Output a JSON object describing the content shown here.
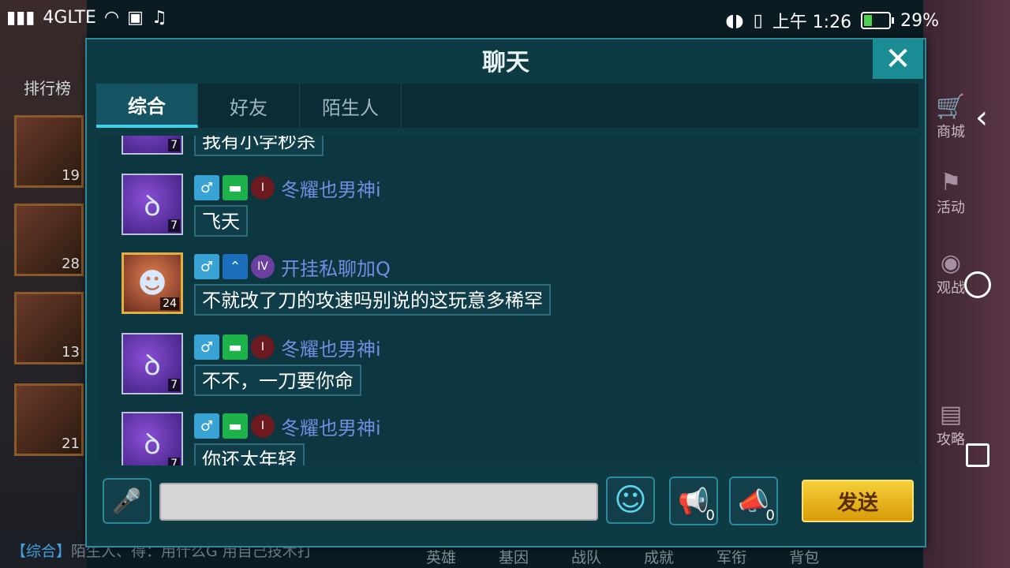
{
  "status_bar": {
    "network": "4GLTE",
    "time": "上午 1:26",
    "battery": "29%"
  },
  "background": {
    "ranking_label": "排行榜",
    "left_levels": [
      "19",
      "28",
      "13",
      "21"
    ],
    "side_buttons": [
      "商城",
      "活动",
      "观战",
      "攻略"
    ],
    "bottom_nav": [
      "英雄",
      "基因",
      "战队",
      "成就",
      "军衔",
      "背包"
    ],
    "ticker_channel": "【综合】",
    "ticker_text": "陌生人、得：用什么G  用自己技术打"
  },
  "dialog": {
    "title": "聊天",
    "tabs": [
      {
        "label": "综合",
        "active": true
      },
      {
        "label": "好友",
        "active": false
      },
      {
        "label": "陌生人",
        "active": false
      }
    ]
  },
  "messages": [
    {
      "name": "冬耀也男神i",
      "level": "7",
      "text": "飞天",
      "rank": "I"
    },
    {
      "name": "开挂私聊加Q",
      "level": "24",
      "text": "不就改了刀的攻速吗别说的这玩意多稀罕",
      "rank": "IV"
    },
    {
      "name": "冬耀也男神i",
      "level": "7",
      "text": "不不，一刀要你命",
      "rank": "I"
    },
    {
      "name": "冬耀也男神i",
      "level": "7",
      "text": "你还太年轻",
      "rank": "I"
    }
  ],
  "partial_top_message": {
    "level": "7",
    "text": "我有小学秒杀"
  },
  "input": {
    "placeholder": "",
    "send_label": "发送",
    "horn_gold_count": "0",
    "horn_silver_count": "0"
  }
}
